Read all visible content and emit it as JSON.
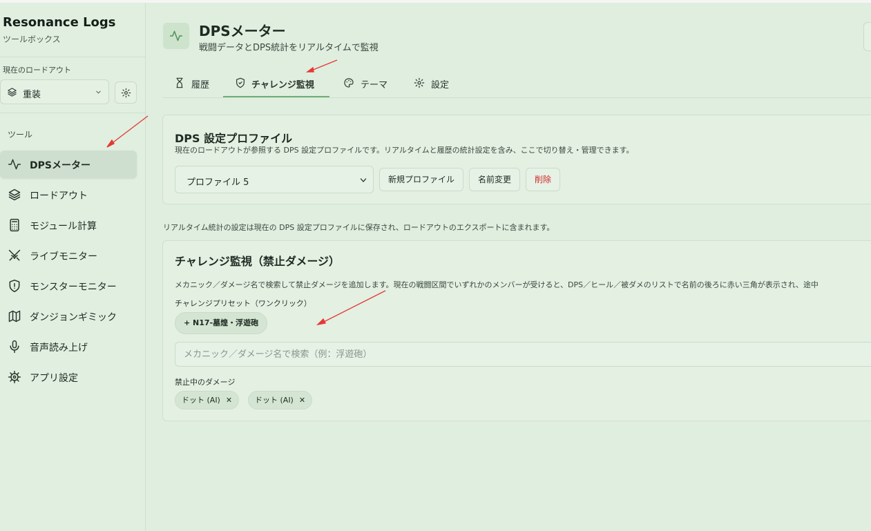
{
  "sidebar": {
    "app_title": "Resonance Logs",
    "app_subtitle": "ツールボックス",
    "loadout_label": "現在のロードアウト",
    "loadout_value": "重装",
    "tools_label": "ツール",
    "items": [
      {
        "label": "DPSメーター",
        "icon": "activity-icon",
        "active": true
      },
      {
        "label": "ロードアウト",
        "icon": "layers-icon"
      },
      {
        "label": "モジュール計算",
        "icon": "calculator-icon"
      },
      {
        "label": "ライブモニター",
        "icon": "swords-icon"
      },
      {
        "label": "モンスターモニター",
        "icon": "shield-alert-icon"
      },
      {
        "label": "ダンジョンギミック",
        "icon": "map-icon"
      },
      {
        "label": "音声読み上げ",
        "icon": "mic-icon"
      },
      {
        "label": "アプリ設定",
        "icon": "cog-icon"
      }
    ]
  },
  "header": {
    "title": "DPSメーター",
    "subtitle": "戦闘データとDPS統計をリアルタイムで監視"
  },
  "tabs": [
    {
      "label": "履歴",
      "icon": "hourglass-icon"
    },
    {
      "label": "チャレンジ監視",
      "icon": "shield-check-icon",
      "active": true
    },
    {
      "label": "テーマ",
      "icon": "palette-icon"
    },
    {
      "label": "設定",
      "icon": "gear-icon"
    }
  ],
  "profile_card": {
    "title": "DPS 設定プロファイル",
    "description": "現在のロードアウトが参照する DPS 設定プロファイルです。リアルタイムと履歴の統計設定を含み、ここで切り替え・管理できます。",
    "selected_profile": "プロファイル 5",
    "new_button": "新規プロファイル",
    "rename_button": "名前変更",
    "delete_button": "削除"
  },
  "note": "リアルタイム統計の設定は現在の DPS 設定プロファイルに保存され、ロードアウトのエクスポートに含まれます。",
  "challenge_card": {
    "title": "チャレンジ監視（禁止ダメージ）",
    "description": "メカニック／ダメージ名で検索して禁止ダメージを追加します。現在の戦闘区間でいずれかのメンバーが受けると、DPS／ヒール／被ダメのリストで名前の後ろに赤い三角が表示され、途中",
    "preset_label": "チャレンジプリセット（ワンクリック）",
    "preset_chip": "+ N17-墓煌・浮遊砲",
    "search_placeholder": "メカニック／ダメージ名で検索（例：浮遊砲）",
    "banned_label": "禁止中のダメージ",
    "banned": [
      "ドット (AI)",
      "ドット (AI)"
    ]
  },
  "colors": {
    "background": "#dfeedf",
    "accent": "#6fae77",
    "danger": "#d02a2a",
    "annotation_arrow": "#e53935"
  }
}
